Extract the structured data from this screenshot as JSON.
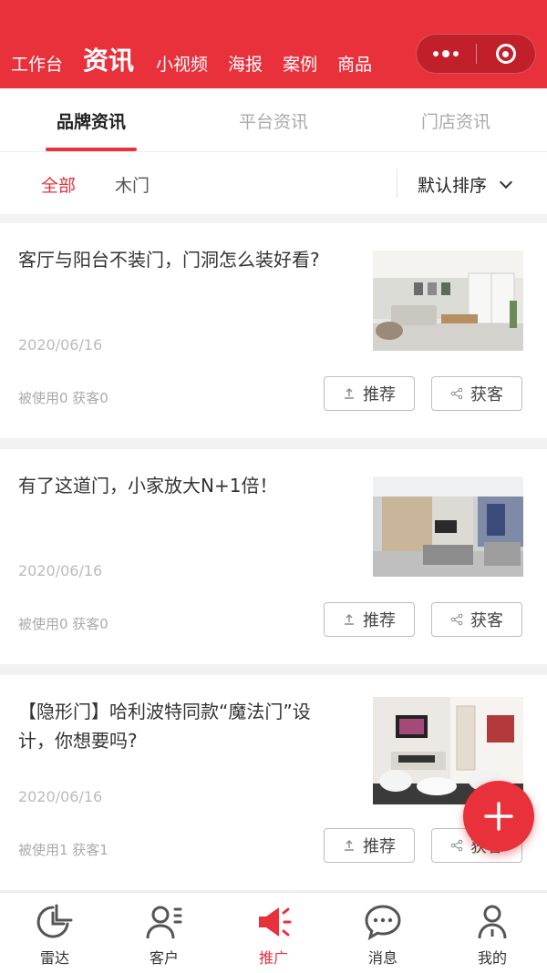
{
  "header": {
    "nav": [
      "工作台",
      "资讯",
      "小视频",
      "海报",
      "案例",
      "商品"
    ],
    "active_nav": "资讯"
  },
  "tabs": [
    "品牌资讯",
    "平台资讯",
    "门店资讯"
  ],
  "filter": {
    "categories": [
      "全部",
      "木门"
    ],
    "sort_label": "默认排序"
  },
  "articles": [
    {
      "title": "客厅与阳台不装门，门洞怎么装好看?",
      "date": "2020/06/16",
      "stats": "被使用0 获客0",
      "recommend": "推荐",
      "acquire": "获客"
    },
    {
      "title": "有了这道门，小家放大N+1倍！",
      "date": "2020/06/16",
      "stats": "被使用0 获客0",
      "recommend": "推荐",
      "acquire": "获客"
    },
    {
      "title": "【隐形门】哈利波特同款“魔法门”设计，你想要吗?",
      "date": "2020/06/16",
      "stats": "被使用1 获客1",
      "recommend": "推荐",
      "acquire": "获客"
    }
  ],
  "tabbar": [
    "雷达",
    "客户",
    "推广",
    "消息",
    "我的"
  ],
  "colors": {
    "accent": "#e8313b"
  }
}
